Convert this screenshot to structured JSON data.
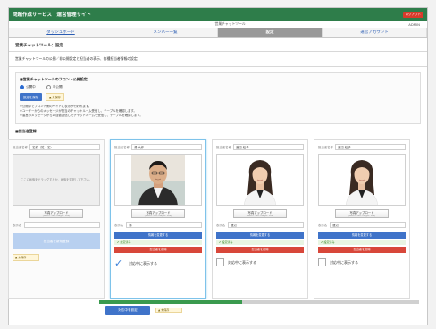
{
  "app": {
    "title": "問題作成サービス｜運営管理サイト",
    "logout_label": "ログアウト",
    "subheader_center": "営業チャットツール",
    "admin_label": "ADMIN"
  },
  "tabs": [
    {
      "label": "ダッシュボード"
    },
    {
      "label": "メンバー一覧"
    },
    {
      "label": "設定"
    },
    {
      "label": "運営アカウント"
    }
  ],
  "page": {
    "title": "営業チャットツール：設定",
    "description": "営業チャットツールの公開／非公開設定と担当者の表示、各種担当者情報の設定。"
  },
  "front": {
    "heading": "■営業チャットツールのフロント公開設定",
    "radio_public": "公開中",
    "radio_private": "非公開",
    "set_button": "設定を保存",
    "warning": "▲ 未保存",
    "notes": [
      "※公開中でフロント側のサイトに表示が行われます。",
      "※ユーザーからのメッセージが担当のチャットルーム受信し、テーブルを確認します。",
      "※運営のメッセージからの自動返信したチャットルームを受信し、テーブルを確認します。"
    ]
  },
  "avatars": {
    "heading": "■担当者登録",
    "panels": [
      {
        "name_label": "担当者名称",
        "name_value": "名前（姓・名）",
        "placeholder_text": "ここに画像をドラッグするか、画像を選択して下さい。",
        "upload_label": "写真アップロード",
        "upload_sub": "(Width: 300, Height: 300)",
        "disp_label": "表示名",
        "disp_value": "",
        "register_label": "担当者を新規登録",
        "warning": "▲ 未保存"
      },
      {
        "name_label": "担当者名称",
        "name_value": "湯 大作",
        "upload_label": "写真アップロード",
        "upload_sub": "(Width: 300, Height: 300)",
        "disp_label": "表示名",
        "disp_value": "湯",
        "update_label": "情報を変更する",
        "status": "✔ 設定済み",
        "delete_label": "担当者を削除",
        "check_label": "対応中に表示する",
        "checked": true
      },
      {
        "name_label": "担当者名称",
        "name_value": "渡辺 絵子",
        "upload_label": "写真アップロード",
        "upload_sub": "(Width: 300, Height: 300)",
        "disp_label": "表示名",
        "disp_value": "渡辺",
        "update_label": "情報を変更する",
        "status": "✔ 設定済み",
        "delete_label": "担当者を削除",
        "check_label": "対応中に表示する",
        "checked": false
      },
      {
        "name_label": "担当者名称",
        "name_value": "渡辺 絵子",
        "upload_label": "写真アップロード",
        "upload_sub": "(Width: 300, Height: 300)",
        "disp_label": "表示名",
        "disp_value": "渡辺",
        "update_label": "情報を変更する",
        "status": "✔ 設定済み",
        "delete_label": "担当者を削除",
        "check_label": "対応中に表示する",
        "checked": false
      }
    ]
  },
  "footer": {
    "save_label": "対応中を設定",
    "warning": "▲ 未保存"
  },
  "colors": {
    "brand_green": "#2e7d4a",
    "accent_blue": "#3f73c9",
    "danger_red": "#d8473a"
  }
}
